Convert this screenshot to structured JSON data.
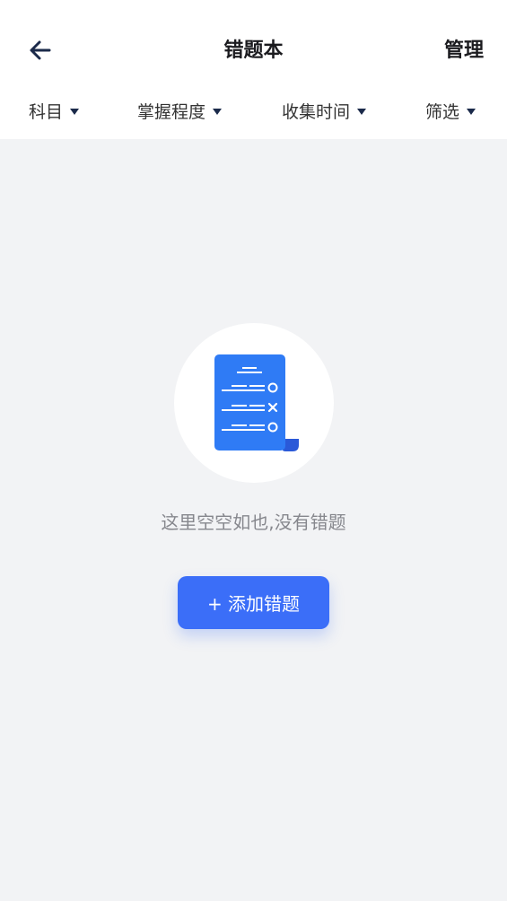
{
  "header": {
    "title": "错题本",
    "manage_label": "管理",
    "back_icon": "arrow-left-icon"
  },
  "filters": [
    {
      "label": "科目",
      "icon": "caret-down-icon"
    },
    {
      "label": "掌握程度",
      "icon": "caret-down-icon"
    },
    {
      "label": "收集时间",
      "icon": "caret-down-icon"
    },
    {
      "label": "筛选",
      "icon": "caret-down-icon"
    }
  ],
  "empty_state": {
    "illustration_icon": "document-checklist-icon",
    "message": "这里空空如也,没有错题",
    "add_button_label": "+ 添加错题"
  },
  "colors": {
    "accent": "#3b6ef8",
    "background": "#f2f3f5",
    "header_bg": "#ffffff",
    "title_text": "#1b1b1f",
    "muted_text": "#86878d"
  }
}
